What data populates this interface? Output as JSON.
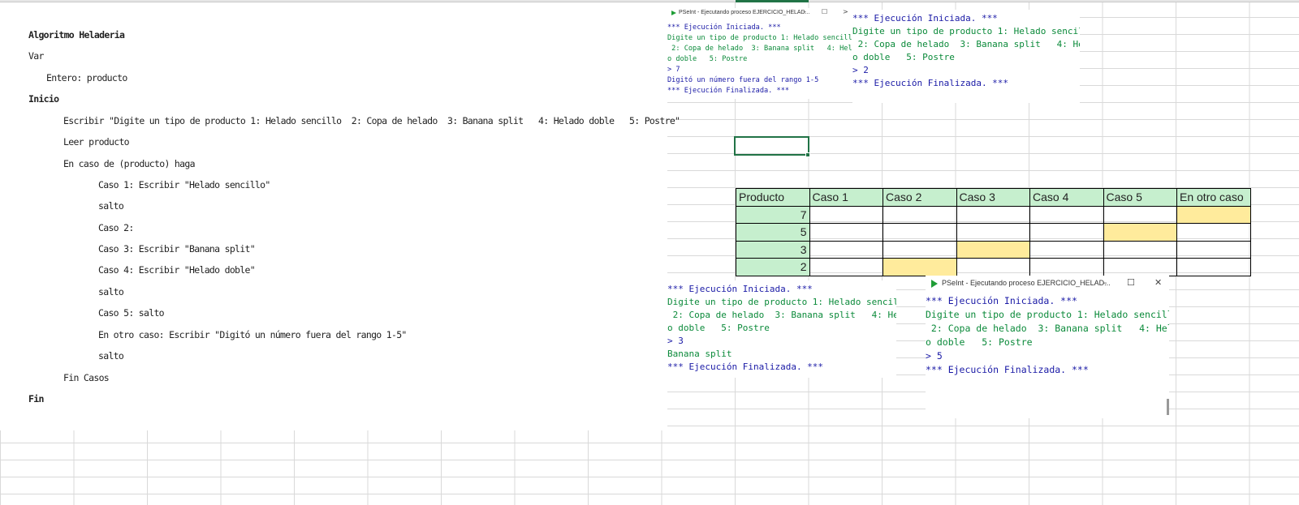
{
  "code": {
    "lines": [
      "Algoritmo Heladeria",
      "Var",
      "Entero: producto",
      "Inicio",
      "Escribir \"Digite un tipo de producto 1: Helado sencillo  2: Copa de helado  3: Banana split   4: Helado doble   5: Postre\"",
      "Leer producto",
      "En caso de (producto) haga",
      "Caso 1: Escribir \"Helado sencillo\"",
      "salto",
      "Caso 2:",
      "Caso 3: Escribir \"Banana split\"",
      "Caso 4: Escribir \"Helado doble\"",
      "salto",
      "Caso 5: salto",
      "En otro caso: Escribir \"Digitó un número fuera del rango 1-5\"",
      "salto",
      "Fin Casos",
      "Fin"
    ]
  },
  "console1": {
    "title": "PSeInt - Ejecutando proceso EJERCICIO_HELAD...",
    "buttons": [
      "–",
      "☐",
      ">"
    ],
    "lines": [
      "*** Ejecución Iniciada. ***",
      "Digite un tipo de producto 1: Helado sencillo",
      " 2: Copa de helado  3: Banana split   4: Helac",
      "o doble   5: Postre",
      "> 7",
      "Digitó un número fuera del rango 1-5",
      "*** Ejecución Finalizada. ***"
    ]
  },
  "console2": {
    "lines": [
      "*** Ejecución Iniciada. ***",
      "Digite un tipo de producto 1: Helado sencillo",
      " 2: Copa de helado  3: Banana split   4: Helad",
      "o doble   5: Postre",
      "> 2",
      "*** Ejecución Finalizada. ***"
    ]
  },
  "console3": {
    "lines": [
      "*** Ejecución Iniciada. ***",
      "Digite un tipo de producto 1: Helado sencillo",
      " 2: Copa de helado  3: Banana split   4: Helad",
      "o doble   5: Postre",
      "> 3",
      "Banana split",
      "*** Ejecución Finalizada. ***"
    ]
  },
  "console4": {
    "title": "PSeInt - Ejecutando proceso EJERCICIO_HELAD...",
    "buttons": [
      "–",
      "☐",
      "✕"
    ],
    "lines": [
      "*** Ejecución Iniciada. ***",
      "Digite un tipo de producto 1: Helado sencillo",
      " 2: Copa de helado  3: Banana split   4: Helad",
      "o doble   5: Postre",
      "> 5",
      "*** Ejecución Finalizada. ***"
    ]
  },
  "table": {
    "headers": [
      "Producto",
      "Caso 1",
      "Caso 2",
      "Caso 3",
      "Caso 4",
      "Caso 5",
      "En otro caso"
    ],
    "rows": [
      {
        "producto": "7",
        "highlight_col": 6
      },
      {
        "producto": "5",
        "highlight_col": 5
      },
      {
        "producto": "3",
        "highlight_col": 3
      },
      {
        "producto": "2",
        "highlight_col": 2
      }
    ]
  },
  "colors": {
    "header_fill": "#c6efce",
    "highlight_fill": "#ffeb9c",
    "console_blue": "#1a1aa6",
    "console_green": "#0b8a3a",
    "excel_green": "#217346"
  }
}
